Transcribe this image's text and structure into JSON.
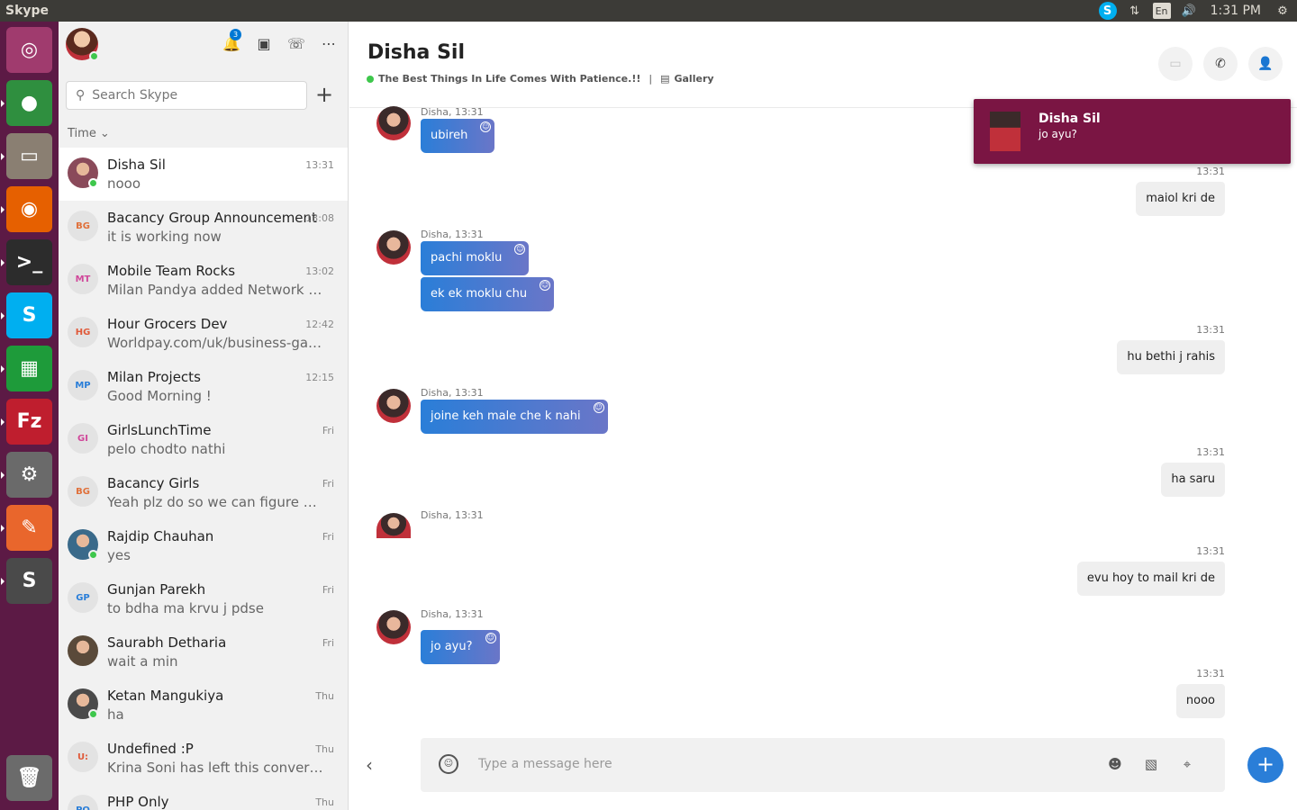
{
  "topbar": {
    "app_title": "Skype",
    "lang": "En",
    "clock": "1:31 PM"
  },
  "launcher": {
    "apps": [
      {
        "name": "ubuntu-dash",
        "glyph": "◎",
        "color": "#a03b6e"
      },
      {
        "name": "chrome",
        "glyph": "●",
        "color": "#2f8f3f"
      },
      {
        "name": "files",
        "glyph": "▭",
        "color": "#8a7f72"
      },
      {
        "name": "firefox",
        "glyph": "◉",
        "color": "#e66000"
      },
      {
        "name": "terminal",
        "glyph": ">_",
        "color": "#2c2c2c"
      },
      {
        "name": "skype",
        "glyph": "S",
        "color": "#00aff0"
      },
      {
        "name": "calc",
        "glyph": "▦",
        "color": "#1e9b3a"
      },
      {
        "name": "filezilla",
        "glyph": "Fz",
        "color": "#bf1e2e"
      },
      {
        "name": "settings",
        "glyph": "⚙",
        "color": "#6a6a6a"
      },
      {
        "name": "postman",
        "glyph": "✎",
        "color": "#e9662c"
      },
      {
        "name": "sublime",
        "glyph": "S",
        "color": "#4a4a4a"
      },
      {
        "name": "trash",
        "glyph": "🗑",
        "color": "#6b6b6b"
      }
    ]
  },
  "sidebar": {
    "notification_count": "3",
    "search_placeholder": "Search Skype",
    "sort_label": "Time",
    "conversations": [
      {
        "name": "Disha Sil",
        "preview": "nooo",
        "time": "13:31",
        "initials": "",
        "initials_color": "#333",
        "online": true,
        "photo": true
      },
      {
        "name": "Bacancy Group Announcement",
        "preview": "it is working now",
        "time": "13:08",
        "initials": "BG",
        "initials_color": "#e0703a",
        "online": false,
        "photo": false
      },
      {
        "name": "Mobile Team Rocks",
        "preview": "Milan Pandya added Network B...",
        "time": "13:02",
        "initials": "MT",
        "initials_color": "#d0479a",
        "online": false,
        "photo": false
      },
      {
        "name": "Hour Grocers Dev",
        "preview": "Worldpay.com/uk/business-gate...",
        "time": "12:42",
        "initials": "HG",
        "initials_color": "#e05a3a",
        "online": false,
        "photo": false
      },
      {
        "name": "Milan Projects",
        "preview": "Good Morning !",
        "time": "12:15",
        "initials": "MP",
        "initials_color": "#2a7ed8",
        "online": false,
        "photo": false
      },
      {
        "name": "GirlsLunchTime",
        "preview": "pelo chodto nathi",
        "time": "Fri",
        "initials": "GI",
        "initials_color": "#d0479a",
        "online": false,
        "photo": false
      },
      {
        "name": "Bacancy Girls",
        "preview": "Yeah plz do so we can figure out p...",
        "time": "Fri",
        "initials": "BG",
        "initials_color": "#e0703a",
        "online": false,
        "photo": false
      },
      {
        "name": "Rajdip Chauhan",
        "preview": "yes",
        "time": "Fri",
        "initials": "",
        "initials_color": "#333",
        "online": true,
        "photo": true
      },
      {
        "name": "Gunjan Parekh",
        "preview": "to bdha ma krvu j pdse",
        "time": "Fri",
        "initials": "GP",
        "initials_color": "#2a7ed8",
        "online": false,
        "photo": false
      },
      {
        "name": "Saurabh Detharia",
        "preview": "wait a min",
        "time": "Fri",
        "initials": "",
        "initials_color": "#333",
        "online": false,
        "photo": true
      },
      {
        "name": "Ketan Mangukiya",
        "preview": "ha",
        "time": "Thu",
        "initials": "",
        "initials_color": "#333",
        "online": true,
        "photo": true
      },
      {
        "name": "Undefined :P",
        "preview": "Krina Soni has left this conversation",
        "time": "Thu",
        "initials": "U:",
        "initials_color": "#e05a3a",
        "online": false,
        "photo": false
      },
      {
        "name": "PHP Only",
        "preview": "",
        "time": "Thu",
        "initials": "PO",
        "initials_color": "#2a7ed8",
        "online": false,
        "photo": false
      }
    ]
  },
  "chat": {
    "title": "Disha Sil",
    "mood": "The Best Things In Life Comes With Patience.!!",
    "separator": "|",
    "gallery_label": "Gallery",
    "messages": [
      {
        "dir": "in",
        "meta": "Disha, 13:31",
        "bubbles": [
          "ubireh"
        ]
      },
      {
        "dir": "out",
        "time": "13:31",
        "text": "maiol kri de"
      },
      {
        "dir": "in",
        "meta": "Disha, 13:31",
        "bubbles": [
          "pachi moklu",
          "ek ek moklu chu"
        ]
      },
      {
        "dir": "out",
        "time": "13:31",
        "text": "hu bethi j rahis"
      },
      {
        "dir": "in",
        "meta": "Disha, 13:31",
        "bubbles": [
          "joine keh male che k nahi"
        ]
      },
      {
        "dir": "out",
        "time": "13:31",
        "text": "ha saru"
      },
      {
        "dir": "in",
        "meta": "Disha, 13:31",
        "bubbles": []
      },
      {
        "dir": "out",
        "time": "13:31",
        "text": "evu hoy to mail kri de"
      },
      {
        "dir": "in",
        "meta": "Disha, 13:31",
        "bubbles": [
          "jo ayu?"
        ]
      },
      {
        "dir": "out",
        "time": "13:31",
        "text": "nooo"
      }
    ],
    "composer_placeholder": "Type a message here"
  },
  "toast": {
    "name": "Disha Sil",
    "message": "jo ayu?"
  }
}
